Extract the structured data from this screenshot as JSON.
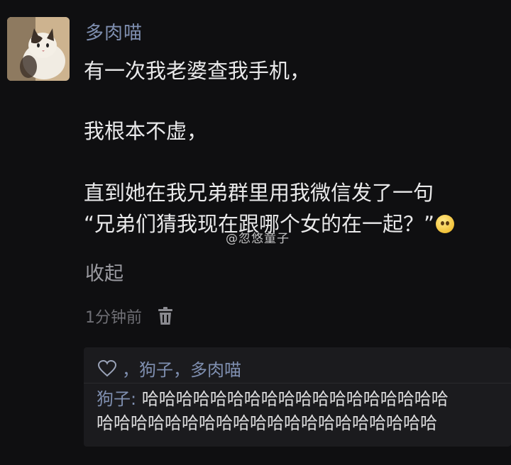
{
  "comment": {
    "author": "多肉喵",
    "lines": [
      "有一次我老婆查我手机，",
      "我根本不虚，",
      "直到她在我兄弟群里用我微信发了一句",
      "“兄弟们猜我现在跟哪个女的在一起？”"
    ],
    "collapse_label": "收起",
    "timestamp": "1分钟前",
    "watermark": "@忽悠童子"
  },
  "likes": {
    "text": "，狗子，多肉喵"
  },
  "reply": {
    "author": "狗子",
    "separator": ": ",
    "line1": "哈哈哈哈哈哈哈哈哈哈哈哈哈哈哈哈哈哈",
    "line2": "哈哈哈哈哈哈哈哈哈哈哈哈哈哈哈哈哈哈哈哈"
  },
  "icons": {
    "avatar": "cat-avatar",
    "delete": "trash-icon",
    "like": "heart-icon",
    "emoji": "smiling-emoji-icon"
  },
  "colors": {
    "background": "#0f0f11",
    "name_link": "#7f8fb0",
    "text": "#e9e9ea",
    "muted": "#6f6f75",
    "panel": "#1b1b1e"
  }
}
